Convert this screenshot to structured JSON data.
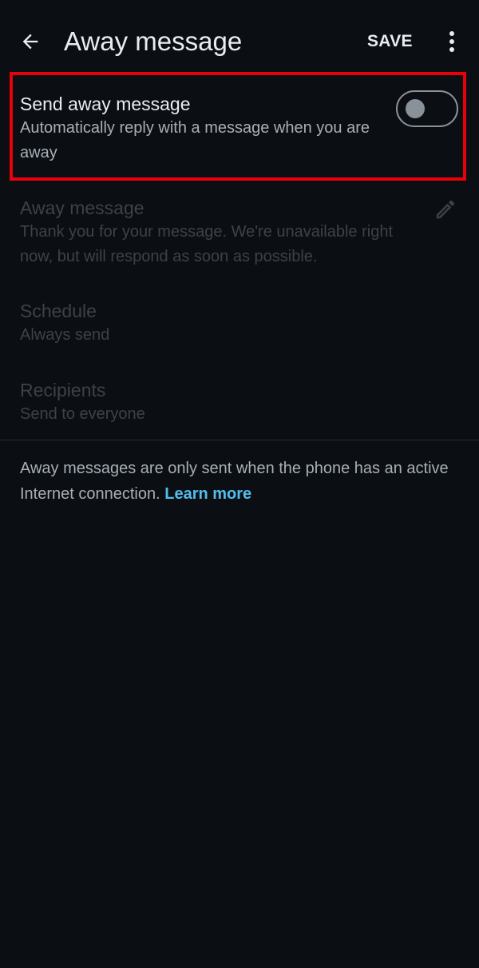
{
  "appbar": {
    "title": "Away message",
    "save_label": "SAVE",
    "back_icon": "arrow-left-icon",
    "more_icon": "more-vertical-icon"
  },
  "send_away": {
    "title": "Send away message",
    "subtitle": "Automatically reply with a message when you are away",
    "enabled": false
  },
  "away_message": {
    "title": "Away message",
    "text": "Thank you for your message. We're unavailable right now, but will respond as soon as possible.",
    "edit_icon": "pencil-icon"
  },
  "schedule": {
    "title": "Schedule",
    "value": "Always send"
  },
  "recipients": {
    "title": "Recipients",
    "value": "Send to everyone"
  },
  "footer": {
    "note": "Away messages are only sent when the phone has an active Internet connection.",
    "learn_more": "Learn more"
  },
  "colors": {
    "background": "#0b0f14",
    "accent": "#53bdeb",
    "highlight": "#e8000b"
  }
}
